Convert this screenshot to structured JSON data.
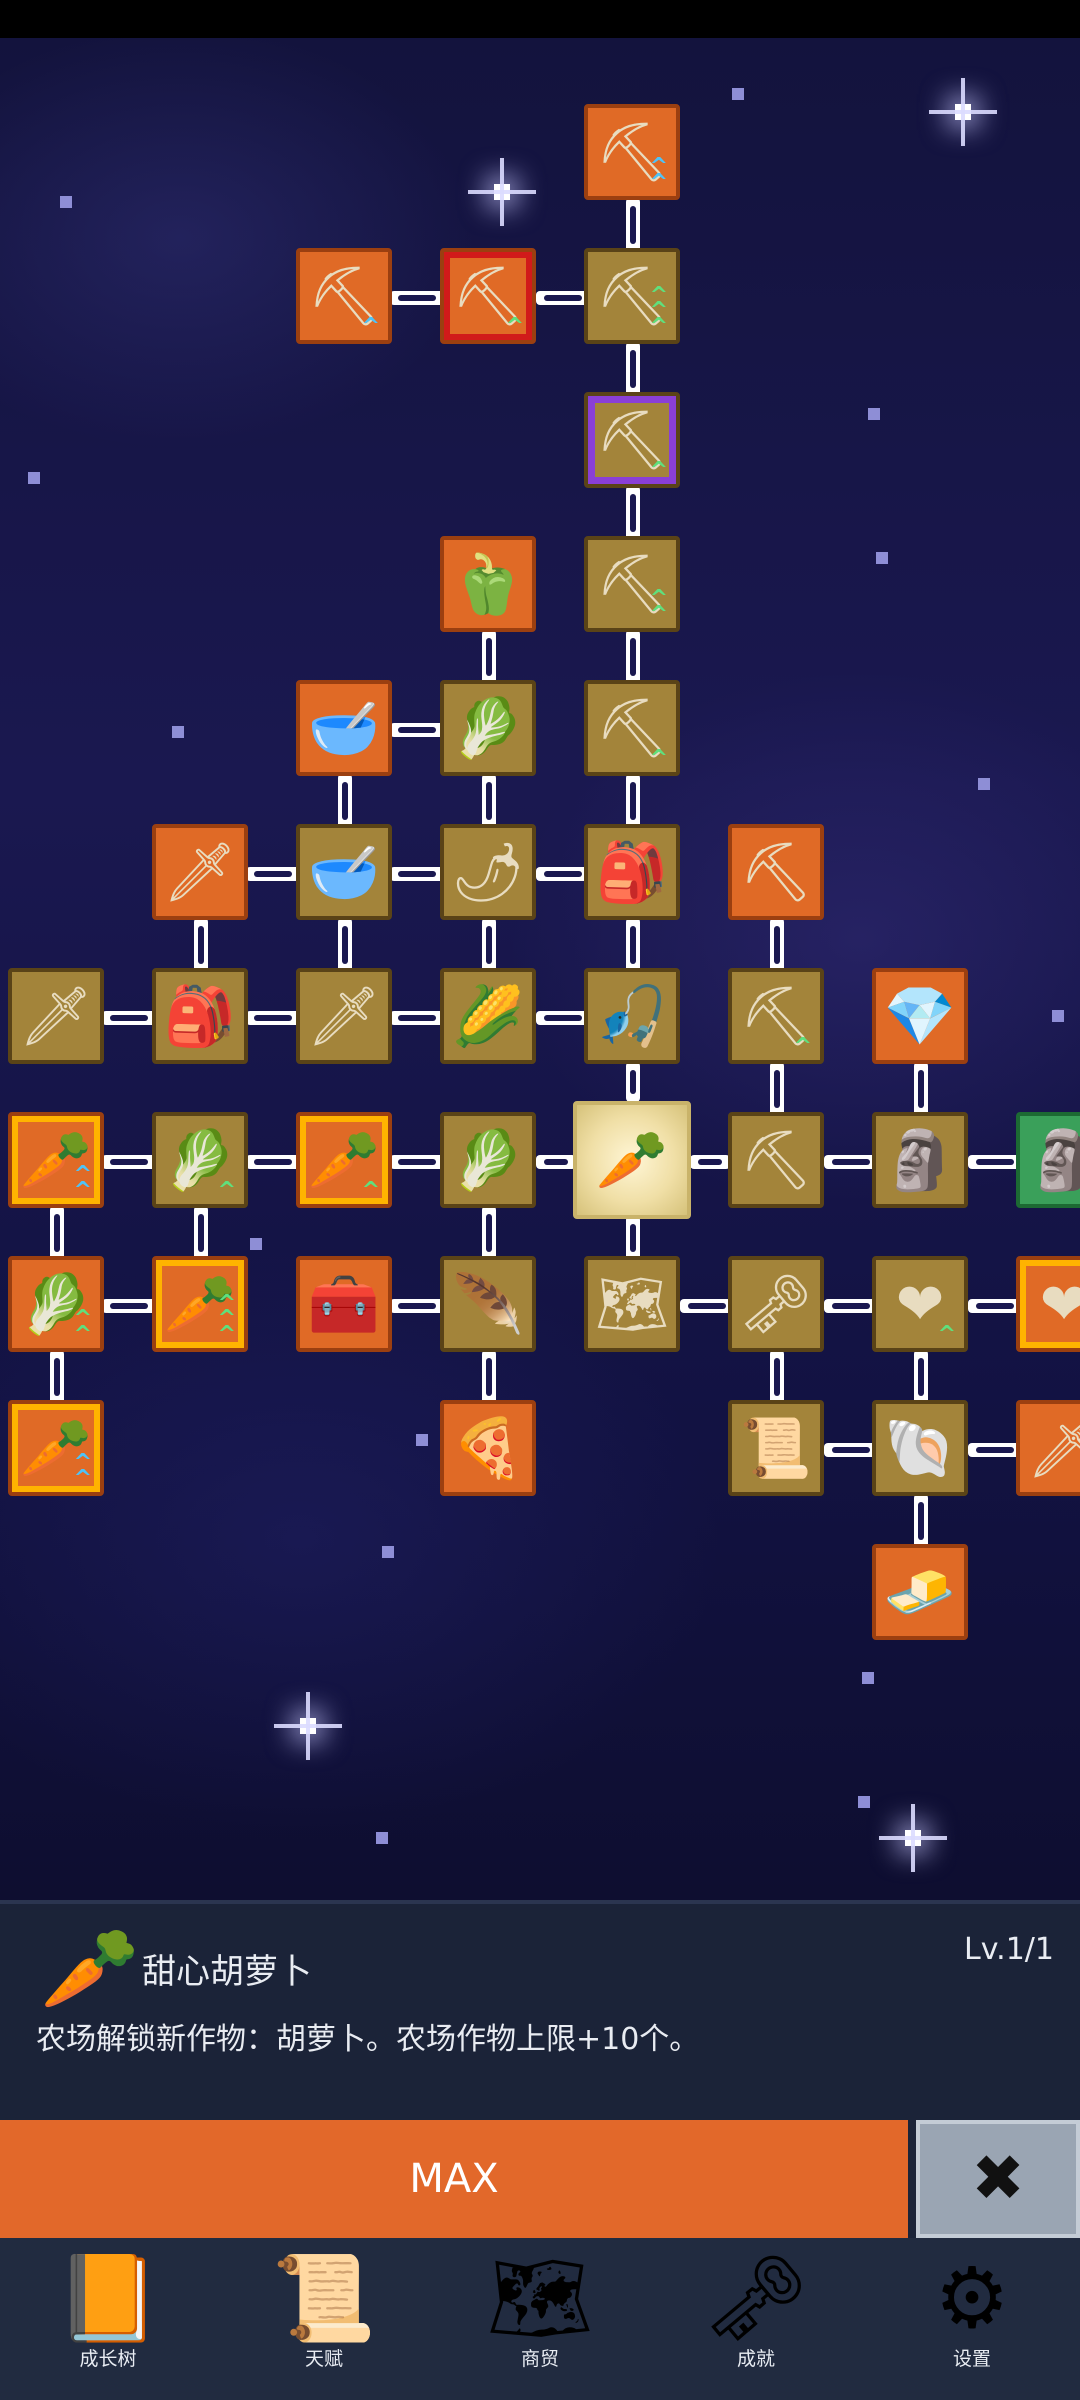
{
  "selected_item": {
    "icon": "carrot-icon",
    "name": "甜心胡萝卜",
    "level": "Lv.1/1",
    "description": "农场解锁新作物：胡萝卜。农场作物上限+10个。"
  },
  "actions": {
    "max_label": "MAX",
    "close_symbol": "✖"
  },
  "tabs": [
    {
      "label": "成长树",
      "icon": "book-icon",
      "glyph": "📙"
    },
    {
      "label": "天赋",
      "icon": "scroll-icon",
      "glyph": "📜"
    },
    {
      "label": "商贸",
      "icon": "map-icon",
      "glyph": "🗺"
    },
    {
      "label": "成就",
      "icon": "key-icon",
      "glyph": "🗝"
    },
    {
      "label": "设置",
      "icon": "gear-icon",
      "glyph": "⚙"
    }
  ],
  "tree_nodes": [
    {
      "icon": "shovel-icon",
      "glyph": "⛏"
    },
    {
      "icon": "shovel-icon",
      "glyph": "⛏"
    },
    {
      "icon": "shovel-icon",
      "glyph": "⛏"
    },
    {
      "icon": "shovel-icon",
      "glyph": "⛏"
    },
    {
      "icon": "shovel-icon",
      "glyph": "⛏"
    },
    {
      "icon": "bell-pepper-icon",
      "glyph": "🫑"
    },
    {
      "icon": "shovel-icon",
      "glyph": "⛏"
    },
    {
      "icon": "bowl-icon",
      "glyph": "🥣"
    },
    {
      "icon": "radish-icon",
      "glyph": "🥬"
    },
    {
      "icon": "shovel-icon",
      "glyph": "⛏"
    },
    {
      "icon": "sword-icon",
      "glyph": "🗡"
    },
    {
      "icon": "bowl-icon",
      "glyph": "🥣"
    },
    {
      "icon": "chili-icon",
      "glyph": "🌶"
    },
    {
      "icon": "backpack-icon",
      "glyph": "🎒"
    },
    {
      "icon": "pickaxe-icon",
      "glyph": "⛏"
    },
    {
      "icon": "sword-icon",
      "glyph": "🗡"
    },
    {
      "icon": "backpack-icon",
      "glyph": "🎒"
    },
    {
      "icon": "sword-icon",
      "glyph": "🗡"
    },
    {
      "icon": "corn-icon",
      "glyph": "🌽"
    },
    {
      "icon": "fishing-rod-icon",
      "glyph": "🎣"
    },
    {
      "icon": "pickaxe-icon",
      "glyph": "⛏"
    },
    {
      "icon": "crystal-icon",
      "glyph": "💎"
    },
    {
      "icon": "carrot-icon",
      "glyph": "🥕"
    },
    {
      "icon": "cabbage-icon",
      "glyph": "🥬"
    },
    {
      "icon": "carrot-icon",
      "glyph": "🥕"
    },
    {
      "icon": "cabbage-icon",
      "glyph": "🥬"
    },
    {
      "icon": "carrot-icon",
      "glyph": "🥕"
    },
    {
      "icon": "pickaxe-icon",
      "glyph": "⛏"
    },
    {
      "icon": "statue-icon",
      "glyph": "🗿"
    },
    {
      "icon": "statue-icon",
      "glyph": "🗿"
    },
    {
      "icon": "cabbage-icon",
      "glyph": "🥬"
    },
    {
      "icon": "carrot-icon",
      "glyph": "🥕"
    },
    {
      "icon": "chest-icon",
      "glyph": "🧰"
    },
    {
      "icon": "feather-icon",
      "glyph": "🪶"
    },
    {
      "icon": "map-icon",
      "glyph": "🗺"
    },
    {
      "icon": "key-icon",
      "glyph": "🗝"
    },
    {
      "icon": "heart-icon",
      "glyph": "❤"
    },
    {
      "icon": "heart-icon",
      "glyph": "❤"
    },
    {
      "icon": "carrot-icon",
      "glyph": "🥕"
    },
    {
      "icon": "pizza-icon",
      "glyph": "🍕"
    },
    {
      "icon": "scroll-icon",
      "glyph": "📜"
    },
    {
      "icon": "fossil-icon",
      "glyph": "🐚"
    },
    {
      "icon": "sword-icon",
      "glyph": "🗡"
    },
    {
      "icon": "butter-icon",
      "glyph": "🧈"
    }
  ]
}
